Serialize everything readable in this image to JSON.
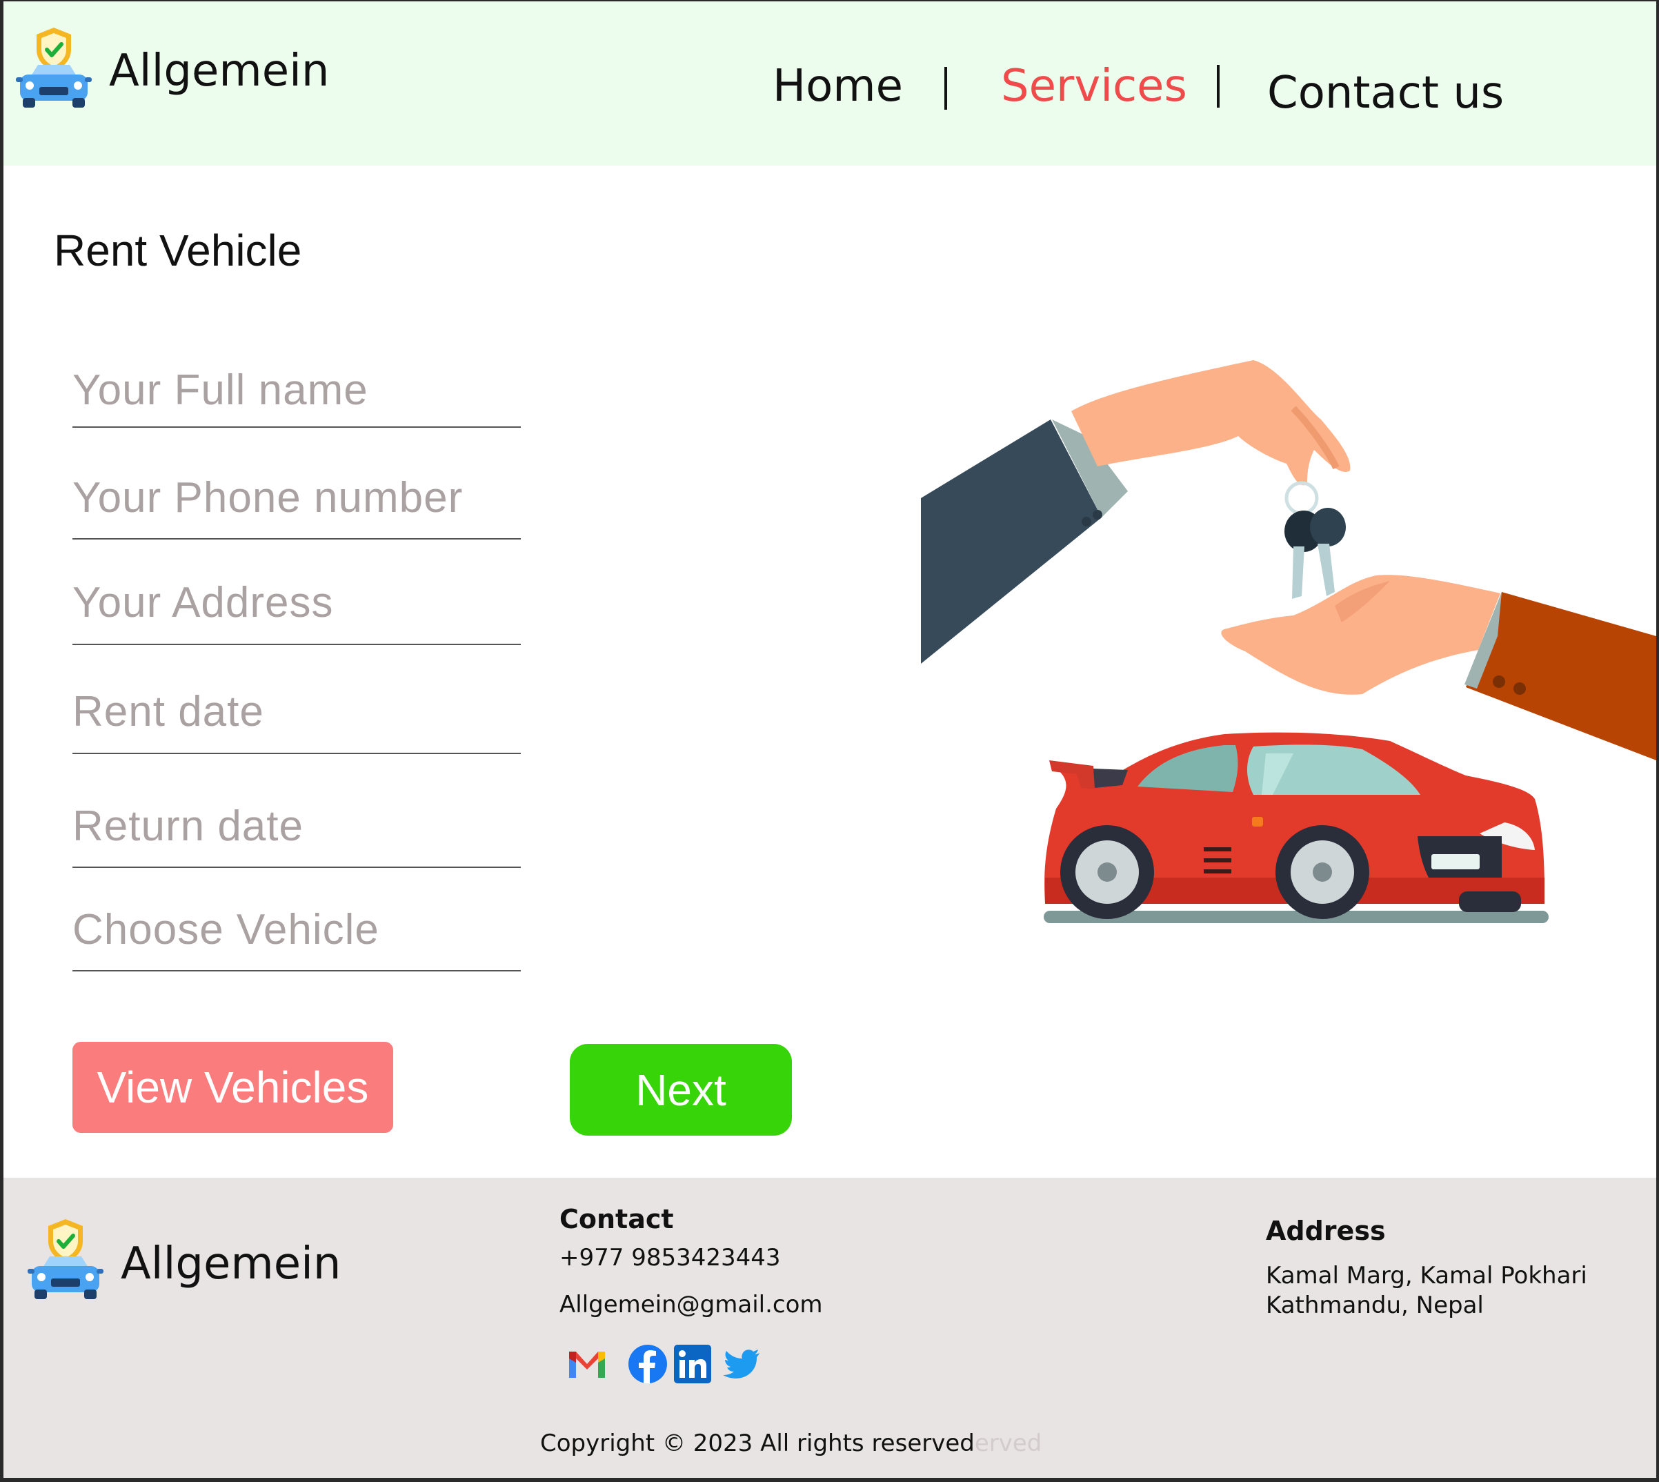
{
  "brand": {
    "name": "Allgemein"
  },
  "nav": {
    "home": "Home",
    "services": "Services",
    "contact": "Contact us",
    "active_color": "#ef4b4b"
  },
  "form": {
    "title": "Rent Vehicle",
    "fields": [
      {
        "placeholder": "Your Full name"
      },
      {
        "placeholder": "Your Phone number"
      },
      {
        "placeholder": "Your Address"
      },
      {
        "placeholder": "Rent date"
      },
      {
        "placeholder": "Return date"
      },
      {
        "placeholder": "Choose Vehicle"
      }
    ],
    "view_button": "View Vehicles",
    "next_button": "Next"
  },
  "colors": {
    "header_bg": "#ecfdee",
    "footer_bg": "#e8e4e4",
    "view_button": "#fb7c7c",
    "next_button": "#37d409"
  },
  "footer": {
    "contact_heading": "Contact",
    "phone": "+977 9853423443",
    "email": "Allgemein@gmail.com",
    "address_heading": "Address",
    "address_line1": "Kamal Marg, Kamal Pokhari",
    "address_line2": "Kathmandu, Nepal",
    "social_icons": [
      "gmail-icon",
      "facebook-icon",
      "linkedin-icon",
      "twitter-icon"
    ],
    "copyright": "Copyright © 2023 All rights reserved",
    "copyright_ghost": "erved"
  }
}
